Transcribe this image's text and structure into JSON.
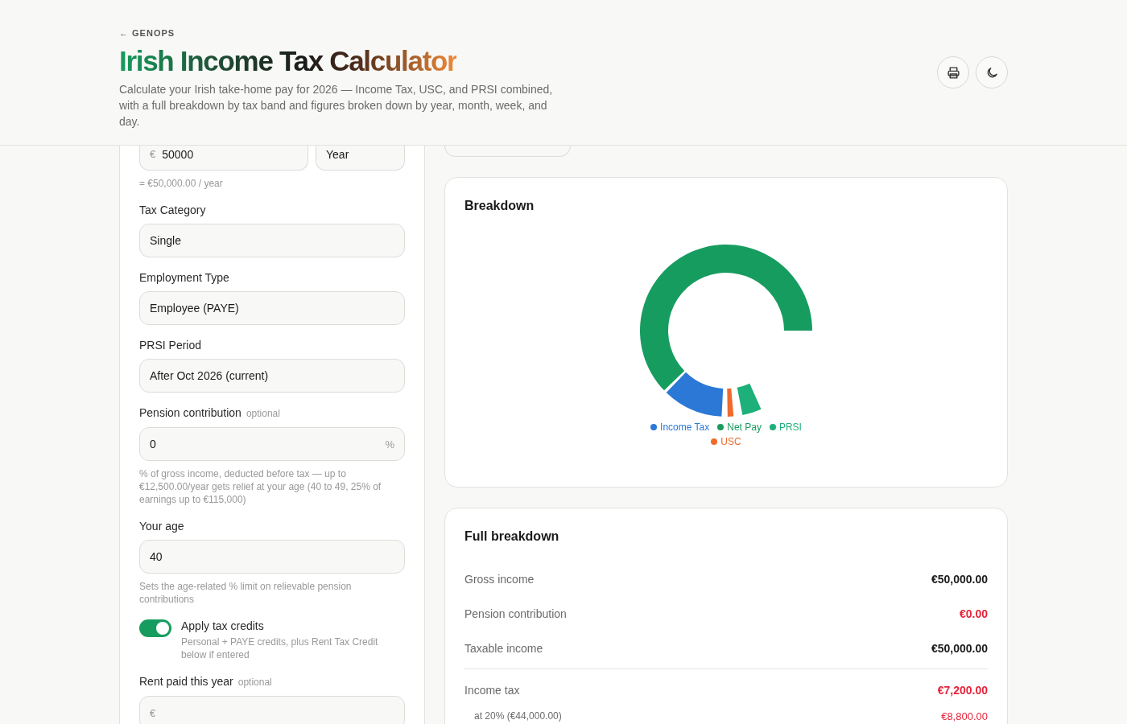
{
  "header": {
    "back_link": "← GENOPS",
    "title": "Irish Income Tax Calculator",
    "description": "Calculate your Irish take-home pay for 2026 — Income Tax, USC, and PRSI combined, with a full breakdown by tax band and figures broken down by year, month, week, and day.",
    "actions": [
      {
        "kind": "print"
      },
      {
        "kind": "theme"
      }
    ]
  },
  "form": [
    {
      "kind": "amount",
      "prefix": "€",
      "value": "50000",
      "period": "Year",
      "hint": "= €50,000.00 / year"
    },
    {
      "kind": "select",
      "label": "Tax Category",
      "value": "Single"
    },
    {
      "kind": "select",
      "label": "Employment Type",
      "value": "Employee (PAYE)"
    },
    {
      "kind": "select",
      "label": "PRSI Period",
      "value": "After Oct 2026 (current)"
    },
    {
      "kind": "input",
      "label": "Pension contribution",
      "optional": "optional",
      "value": "0",
      "suffix": "%",
      "hint": "% of gross income, deducted before tax — up to €12,500.00/year gets relief at your age (40 to 49, 25% of earnings up to €115,000)"
    },
    {
      "kind": "input",
      "label": "Your age",
      "value": "40",
      "hint": "Sets the age-related % limit on relievable pension contributions"
    },
    {
      "kind": "toggle",
      "label": "Apply tax credits",
      "checked": true,
      "hint": "Personal + PAYE credits, plus Rent Tax Credit below if entered"
    },
    {
      "kind": "input",
      "label": "Rent paid this year",
      "optional": "optional",
      "prefix": "€"
    }
  ],
  "copy_link": {
    "kind": "button"
  },
  "breakdown": {
    "title": "Breakdown",
    "legend": [
      {
        "label": "Income Tax",
        "color": "#2b78d6"
      },
      {
        "label": "Net Pay",
        "color": "#179c5f"
      },
      {
        "label": "PRSI",
        "color": "#1db07a"
      },
      {
        "label": "USC",
        "color": "#ee6a2e"
      }
    ]
  },
  "full_breakdown": {
    "title": "Full breakdown",
    "rows": [
      {
        "kind": "amount",
        "label": "Gross income",
        "value": "€50,000.00"
      },
      {
        "kind": "deduction",
        "label": "Pension contribution",
        "value": "€0.00"
      },
      {
        "kind": "amount",
        "label": "Taxable income",
        "value": "€50,000.00"
      },
      {
        "kind": "divider"
      },
      {
        "kind": "deduction",
        "label": "Income tax",
        "value": "€7,200.00"
      },
      {
        "kind": "band",
        "label": "at 20% (€44,000.00)",
        "value": "€8,800.00"
      }
    ]
  }
}
